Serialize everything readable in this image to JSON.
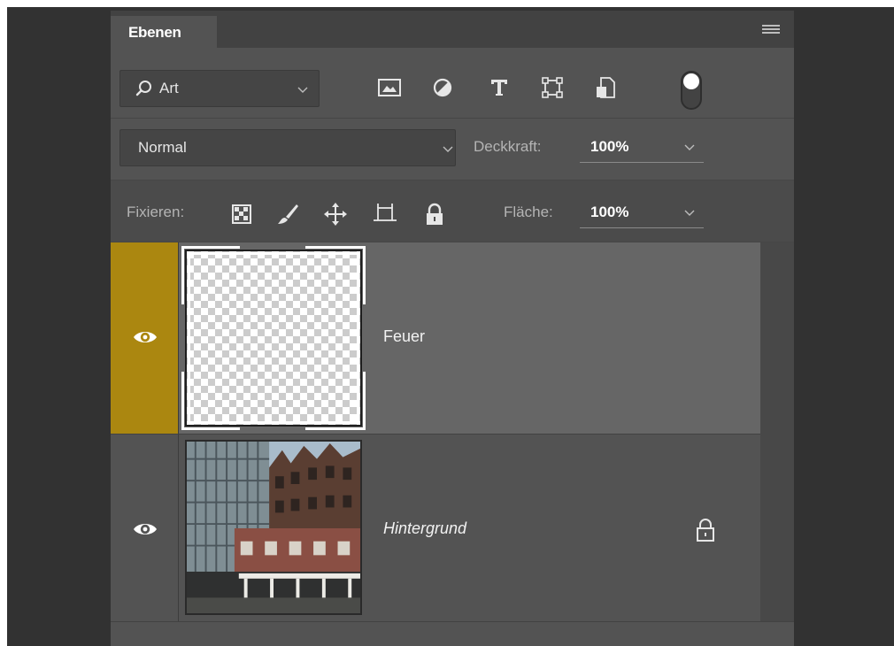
{
  "panel": {
    "tab_label": "Ebenen"
  },
  "filter": {
    "kind_label": "Art",
    "icons": [
      "pixel-layer-filter-icon",
      "adjustment-layer-filter-icon",
      "type-layer-filter-icon",
      "shape-layer-filter-icon",
      "smart-object-filter-icon"
    ]
  },
  "blend": {
    "mode": "Normal",
    "opacity_label": "Deckkraft:",
    "opacity_value": "100%"
  },
  "lock": {
    "label": "Fixieren:",
    "fill_label": "Fläche:",
    "fill_value": "100%"
  },
  "layers": [
    {
      "name": "Feuer",
      "selected": true,
      "visible": true,
      "locked": false
    },
    {
      "name": "Hintergrund",
      "selected": false,
      "visible": true,
      "locked": true
    }
  ],
  "colors": {
    "selection_accent": "#ab8710",
    "panel_bg": "#535353",
    "selected_row": "#666666"
  }
}
